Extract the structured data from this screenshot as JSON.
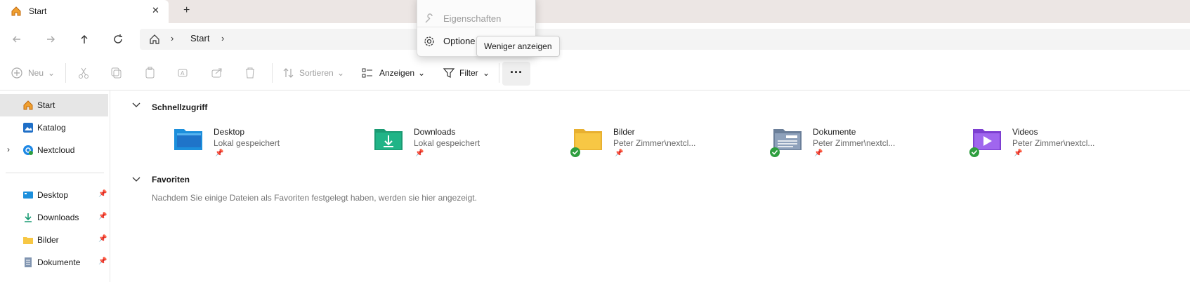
{
  "window": {
    "tab_title": "Start",
    "close_symbol": "✕",
    "newtab_symbol": "+"
  },
  "nav": {
    "back_icon": "arrow-left",
    "forward_icon": "arrow-right",
    "up_icon": "arrow-up",
    "refresh_icon": "refresh",
    "breadcrumb": [
      "Start"
    ],
    "sep": "›"
  },
  "toolbar": {
    "new_label": "Neu",
    "sort_label": "Sortieren",
    "view_label": "Anzeigen",
    "filter_label": "Filter",
    "more_label": "···"
  },
  "menu": {
    "properties_label": "Eigenschaften",
    "options_label": "Optione",
    "tooltip": "Weniger anzeigen"
  },
  "sidebar": {
    "items": [
      {
        "label": "Start",
        "icon": "home-icon"
      },
      {
        "label": "Katalog",
        "icon": "gallery-icon"
      },
      {
        "label": "Nextcloud",
        "icon": "nextcloud-icon"
      }
    ],
    "pinned": [
      {
        "label": "Desktop",
        "icon": "desktop-folder-icon"
      },
      {
        "label": "Downloads",
        "icon": "download-icon"
      },
      {
        "label": "Bilder",
        "icon": "folder-icon"
      },
      {
        "label": "Dokumente",
        "icon": "documents-icon"
      }
    ]
  },
  "main": {
    "quick_access_title": "Schnellzugriff",
    "favorites_title": "Favoriten",
    "favorites_empty": "Nachdem Sie einige Dateien als Favoriten festgelegt haben, werden sie hier angezeigt.",
    "quick_access": [
      {
        "name": "Desktop",
        "sub": "Lokal gespeichert",
        "icon": "desktop-folder-icon",
        "synced": false
      },
      {
        "name": "Downloads",
        "sub": "Lokal gespeichert",
        "icon": "downloads-folder-icon",
        "synced": false
      },
      {
        "name": "Bilder",
        "sub": "Peter Zimmer\\nextcl...",
        "icon": "pictures-folder-icon",
        "synced": true
      },
      {
        "name": "Dokumente",
        "sub": "Peter Zimmer\\nextcl...",
        "icon": "documents-folder-icon",
        "synced": true
      },
      {
        "name": "Videos",
        "sub": "Peter Zimmer\\nextcl...",
        "icon": "videos-folder-icon",
        "synced": true
      }
    ]
  },
  "colors": {
    "accent": "#0067c0",
    "sync_green": "#2e9e3f",
    "folder_yellow": "#f7c744"
  }
}
